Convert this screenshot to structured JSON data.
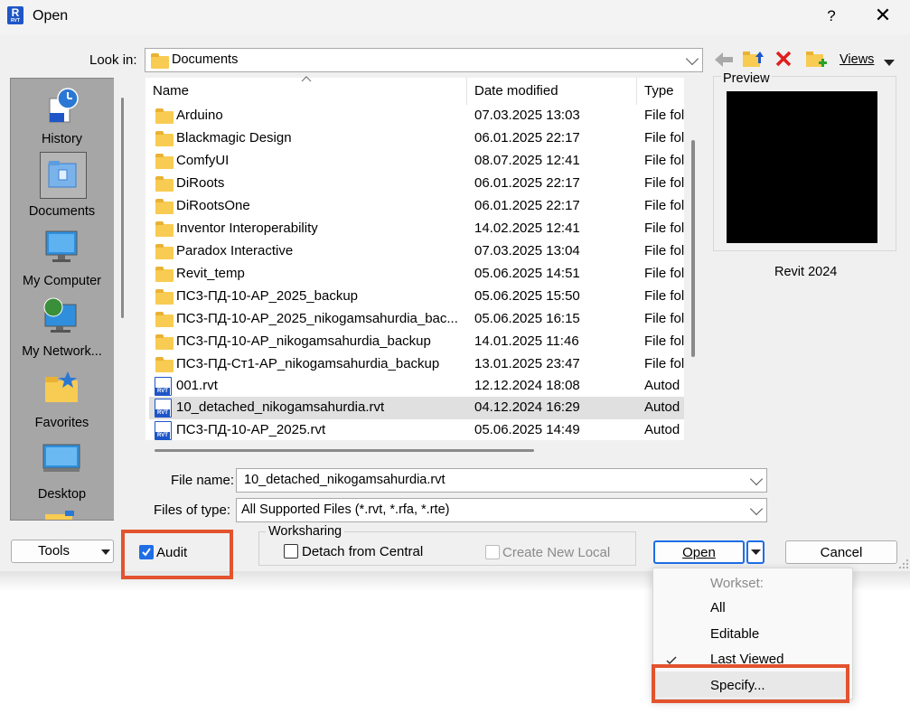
{
  "window": {
    "title": "Open",
    "help_glyph": "?",
    "close_glyph": "✕",
    "app_icon": "revit-icon",
    "app_icon_letter": "R",
    "app_icon_sub": "RVT"
  },
  "lookin": {
    "label": "Look in:",
    "value": "Documents",
    "views_label": "Views"
  },
  "toolbar_icons": [
    "back-arrow-icon",
    "up-folder-icon",
    "delete-icon",
    "new-folder-icon",
    "views-dropdown-icon"
  ],
  "places": [
    {
      "label": "History",
      "icon": "history-icon"
    },
    {
      "label": "Documents",
      "icon": "documents-icon"
    },
    {
      "label": "My Computer",
      "icon": "computer-icon"
    },
    {
      "label": "My Network...",
      "icon": "network-icon"
    },
    {
      "label": "Favorites",
      "icon": "favorites-icon"
    },
    {
      "label": "Desktop",
      "icon": "desktop-icon"
    }
  ],
  "filelist": {
    "columns": {
      "name": "Name",
      "date": "Date modified",
      "type": "Type"
    },
    "rows": [
      {
        "name": "Arduino",
        "date": "07.03.2025 13:03",
        "type": "File fol",
        "kind": "folder"
      },
      {
        "name": "Blackmagic Design",
        "date": "06.01.2025 22:17",
        "type": "File fol",
        "kind": "folder"
      },
      {
        "name": "ComfyUI",
        "date": "08.07.2025 12:41",
        "type": "File fol",
        "kind": "folder"
      },
      {
        "name": "DiRoots",
        "date": "06.01.2025 22:17",
        "type": "File fol",
        "kind": "folder"
      },
      {
        "name": "DiRootsOne",
        "date": "06.01.2025 22:17",
        "type": "File fol",
        "kind": "folder"
      },
      {
        "name": "Inventor Interoperability",
        "date": "14.02.2025 12:41",
        "type": "File fol",
        "kind": "folder"
      },
      {
        "name": "Paradox Interactive",
        "date": "07.03.2025 13:04",
        "type": "File fol",
        "kind": "folder"
      },
      {
        "name": "Revit_temp",
        "date": "05.06.2025 14:51",
        "type": "File fol",
        "kind": "folder"
      },
      {
        "name": "ПС3-ПД-10-АР_2025_backup",
        "date": "05.06.2025 15:50",
        "type": "File fol",
        "kind": "folder"
      },
      {
        "name": "ПС3-ПД-10-АР_2025_nikogamsahurdia_bac...",
        "date": "05.06.2025 16:15",
        "type": "File fol",
        "kind": "folder"
      },
      {
        "name": "ПС3-ПД-10-АР_nikogamsahurdia_backup",
        "date": "14.01.2025 11:46",
        "type": "File fol",
        "kind": "folder"
      },
      {
        "name": "ПС3-ПД-Ст1-АР_nikogamsahurdia_backup",
        "date": "13.01.2025 23:47",
        "type": "File fol",
        "kind": "folder"
      },
      {
        "name": "001.rvt",
        "date": "12.12.2024 18:08",
        "type": "Autod",
        "kind": "rvt"
      },
      {
        "name": "10_detached_nikogamsahurdia.rvt",
        "date": "04.12.2024 16:29",
        "type": "Autod",
        "kind": "rvt",
        "selected": true
      },
      {
        "name": "ПС3-ПД-10-АР_2025.rvt",
        "date": "05.06.2025 14:49",
        "type": "Autod",
        "kind": "rvt"
      }
    ]
  },
  "preview": {
    "label": "Preview",
    "caption": "Revit 2024"
  },
  "filename": {
    "label": "File name:",
    "value": "10_detached_nikogamsahurdia.rvt"
  },
  "filetype": {
    "label": "Files of type:",
    "value": "All Supported Files (*.rvt, *.rfa, *.rte)"
  },
  "buttons": {
    "tools": "Tools",
    "open": "Open",
    "cancel": "Cancel"
  },
  "audit": {
    "label": "Audit",
    "checked": true
  },
  "worksharing": {
    "label": "Worksharing",
    "detach_label": "Detach from Central",
    "detach_checked": false,
    "create_local_label": "Create New Local",
    "create_local_enabled": false
  },
  "workset_menu": {
    "header": "Workset:",
    "items": [
      {
        "label": "All",
        "checked": false
      },
      {
        "label": "Editable",
        "checked": false
      },
      {
        "label": "Last Viewed",
        "checked": true
      },
      {
        "label": "Specify...",
        "checked": false
      }
    ]
  },
  "colors": {
    "highlight_box": "#e2532e",
    "accent": "#1e56c8",
    "folder": "#f8cb52"
  }
}
